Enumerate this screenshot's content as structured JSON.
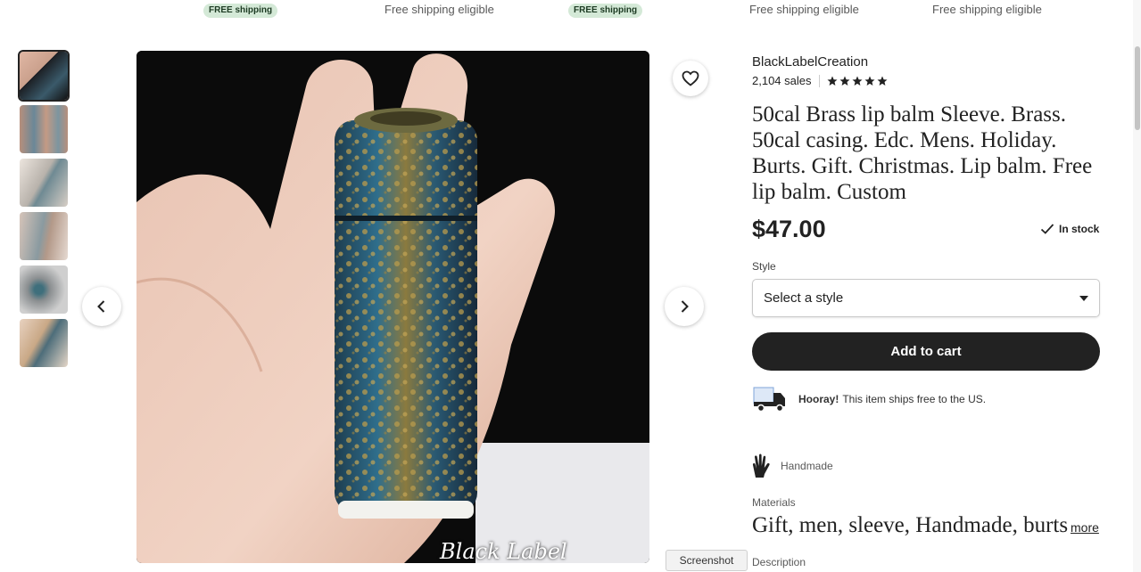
{
  "top_strip": [
    {
      "text": "FREE shipping",
      "style": "badge"
    },
    {
      "text": "Free shipping eligible",
      "style": "text"
    },
    {
      "text": "FREE shipping",
      "style": "badge"
    },
    {
      "text": "Free shipping eligible",
      "style": "text"
    },
    {
      "text": "Free shipping eligible",
      "style": "text"
    }
  ],
  "gallery": {
    "thumbnail_count": 6,
    "active_index": 0,
    "watermark": "Black Label Creation",
    "prev_icon": "chevron-left-icon",
    "next_icon": "chevron-right-icon",
    "favorite_icon": "heart-icon"
  },
  "listing": {
    "shop_name": "BlackLabelCreation",
    "sales": "2,104 sales",
    "rating": 5,
    "title": "50cal Brass lip balm Sleeve. Brass. 50cal casing. Edc. Mens. Holiday. Burts. Gift. Christmas. Lip balm. Free lip balm. Custom",
    "price": "$47.00",
    "stock": "In stock",
    "style_label": "Style",
    "style_placeholder": "Select a style",
    "add_to_cart": "Add to cart",
    "shipping_strong": "Hooray!",
    "shipping_text": "This item ships free to the US.",
    "handmade": "Handmade",
    "materials_label": "Materials",
    "materials_value": "Gift, men, sleeve, Handmade, burts",
    "more_link": "more",
    "description_label": "Description"
  },
  "tooltip": "Screenshot",
  "colors": {
    "accent_dark": "#222222",
    "badge_bg": "#d4e9d7",
    "badge_text": "#1c3a22"
  }
}
